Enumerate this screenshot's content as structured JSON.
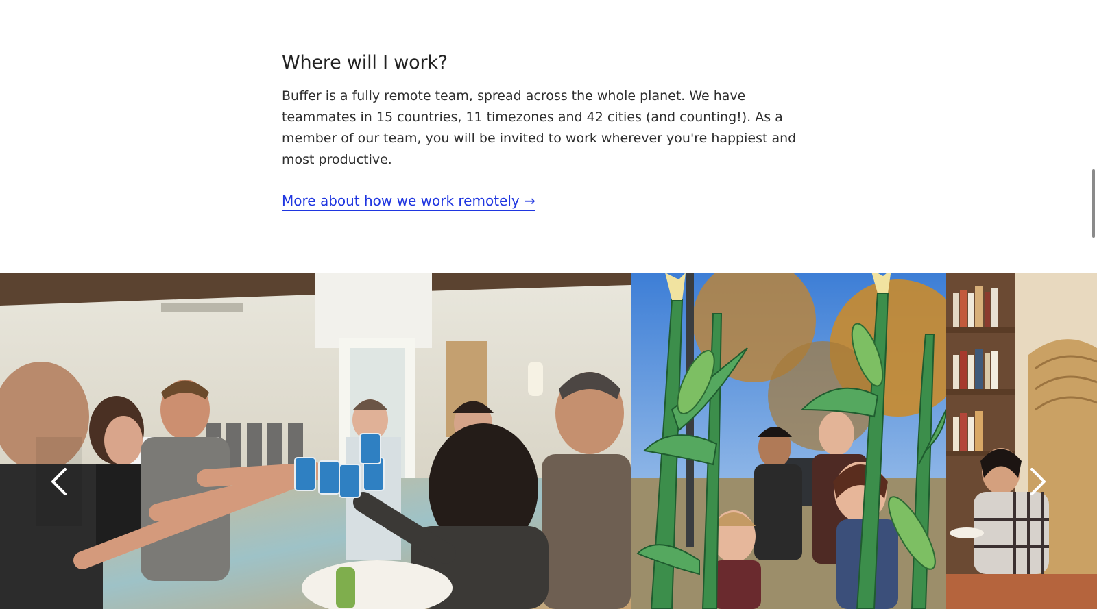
{
  "section": {
    "heading": "Where will I work?",
    "paragraph": "Buffer is a fully remote team, spread across the whole planet. We have teammates in 15 countries, 11 timezones and 42 cities (and counting!). As a member of our team, you will be invited to work wherever you're happiest and most productive.",
    "link_label": "More about how we work remotely →",
    "link_color": "#1f36e0"
  },
  "gallery": {
    "photos": [
      {
        "subject": "team-toast-photo"
      },
      {
        "subject": "team-corn-sculpture-photo"
      },
      {
        "subject": "bookshelf-room-photo"
      }
    ],
    "prev_icon": "chevron-left-icon",
    "next_icon": "chevron-right-icon"
  }
}
